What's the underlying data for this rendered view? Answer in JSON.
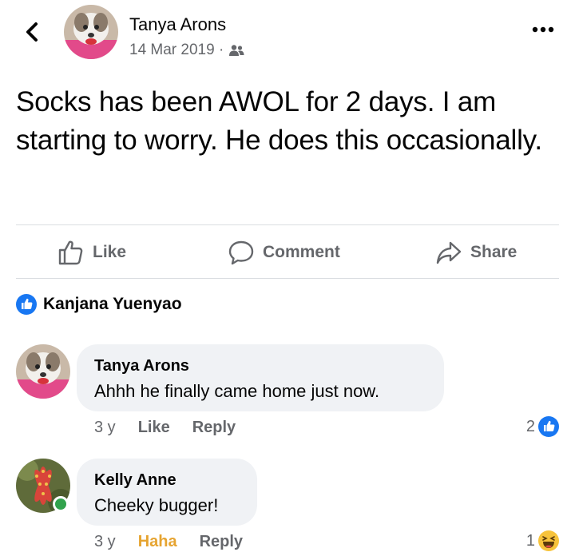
{
  "header": {
    "author": "Tanya Arons",
    "date": "14 Mar 2019 ·",
    "privacy_icon": "friends-icon"
  },
  "post": {
    "text": "Socks has been AWOL for 2 days.  I am starting to worry.  He does this occasionally."
  },
  "actions": {
    "like": "Like",
    "comment": "Comment",
    "share": "Share"
  },
  "reactions": {
    "names": "Kanjana Yuenyao"
  },
  "comments": [
    {
      "author": "Tanya Arons",
      "text": "Ahhh he finally came home just now.",
      "time": "3 y",
      "action1": "Like",
      "action2": "Reply",
      "reaction_count": "2",
      "reaction_type": "like"
    },
    {
      "author": "Kelly Anne",
      "text": "Cheeky bugger!",
      "time": "3 y",
      "action1": "Haha",
      "action2": "Reply",
      "reaction_count": "1",
      "reaction_type": "haha",
      "online": true
    }
  ],
  "colors": {
    "accent": "#1877f2",
    "muted": "#65676b",
    "bubble": "#f0f2f5",
    "haha": "#e6a431",
    "online": "#31a24c"
  }
}
